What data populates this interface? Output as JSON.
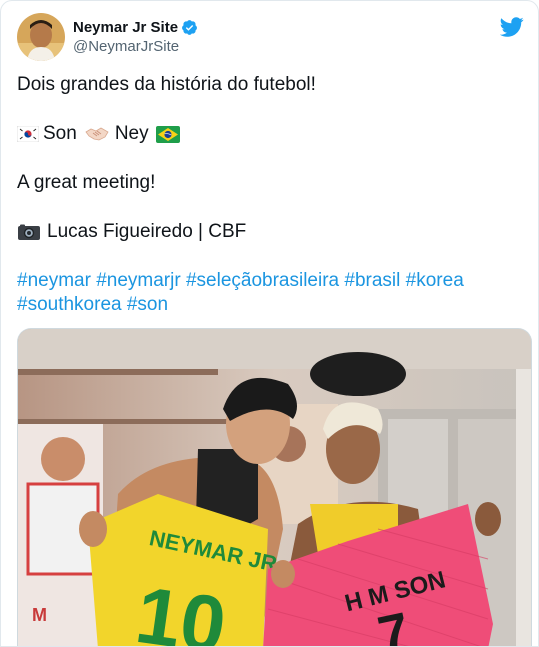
{
  "author": {
    "display_name": "Neymar Jr Site",
    "handle": "@NeymarJrSite",
    "verified": true,
    "avatar_icon": "avatar-photo"
  },
  "platform_icon": "twitter-bird-icon",
  "tweet": {
    "line1": "Dois grandes da história do futebol!",
    "line2_left": "Son",
    "line2_right": "Ney",
    "line3": "A great meeting!",
    "line4_credit": "Lucas Figueiredo | CBF",
    "hashtags_row1": [
      "#neymar",
      "#neymarjr",
      "#seleçãobrasileira",
      "#brasil",
      "#korea"
    ],
    "hashtags_row2": [
      "#southkorea",
      "#son"
    ]
  },
  "photo": {
    "shirt_left_name": "NEYMAR JR",
    "shirt_left_number": "10",
    "shirt_right_name": "H M SON",
    "shirt_right_number": "7"
  },
  "colors": {
    "hashtag": "#1b95e0",
    "verified": "#1da1f2",
    "brand": "#1da1f2",
    "jersey_yellow": "#f2d52b",
    "jersey_green": "#1f8a3a",
    "jersey_pink": "#ef4d78"
  }
}
